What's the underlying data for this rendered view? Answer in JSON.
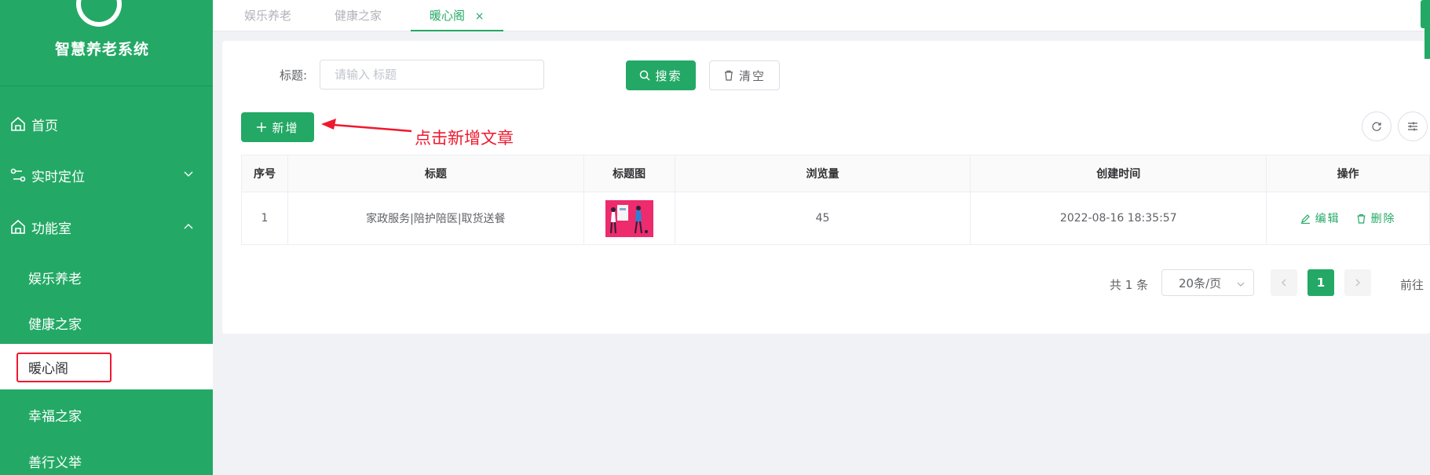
{
  "app": {
    "title": "智慧养老系统"
  },
  "colors": {
    "brand": "#23a965",
    "annotation": "#f0182e"
  },
  "sidebar": {
    "items": [
      {
        "label": "首页",
        "icon": "home-icon"
      },
      {
        "label": "实时定位",
        "icon": "route-icon",
        "expanded": false
      },
      {
        "label": "功能室",
        "icon": "home-icon",
        "expanded": true
      }
    ],
    "sub_items": [
      {
        "label": "娱乐养老"
      },
      {
        "label": "健康之家"
      },
      {
        "label": "暖心阁",
        "active": true
      },
      {
        "label": "幸福之家"
      },
      {
        "label": "善行义举"
      }
    ]
  },
  "tabs": [
    {
      "label": "娱乐养老"
    },
    {
      "label": "健康之家"
    },
    {
      "label": "暖心阁",
      "active": true,
      "close": "×"
    }
  ],
  "search": {
    "label": "标题:",
    "placeholder": "请输入 标题",
    "search_label": "搜索",
    "clear_label": "清空"
  },
  "toolbar": {
    "add_label": "新增"
  },
  "annotation": {
    "text": "点击新增文章"
  },
  "table": {
    "columns": [
      "序号",
      "标题",
      "标题图",
      "浏览量",
      "创建时间",
      "操作"
    ],
    "rows": [
      {
        "index": "1",
        "title": "家政服务|陪护陪医|取货送餐",
        "views": "45",
        "created": "2022-08-16 18:35:57"
      }
    ],
    "edit_label": "编辑",
    "delete_label": "删除"
  },
  "pagination": {
    "total": "共 1 条",
    "page_size": "20条/页",
    "current_page": "1",
    "goto_label": "前往"
  }
}
